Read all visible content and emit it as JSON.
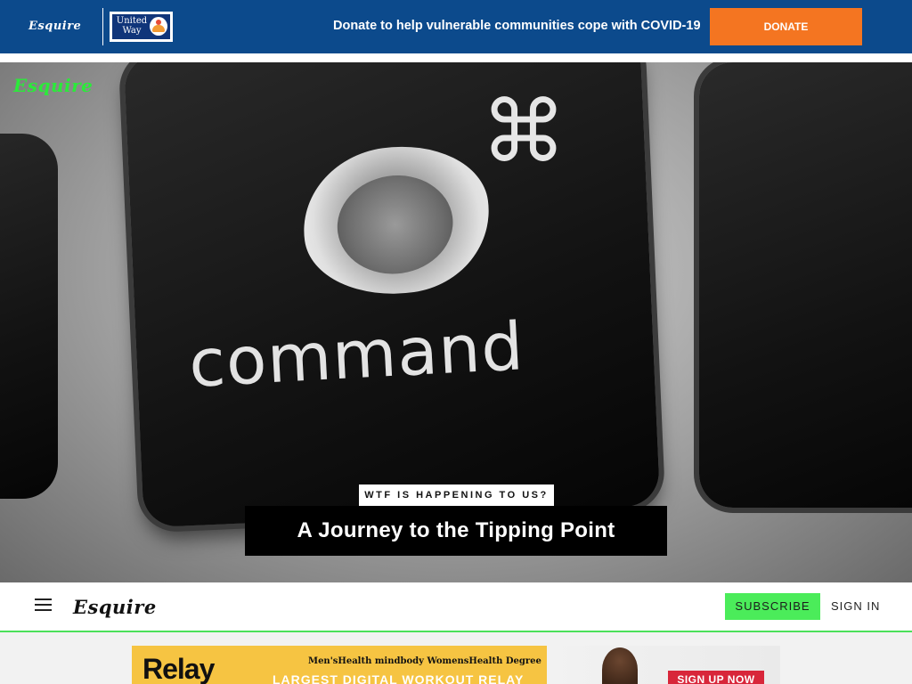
{
  "banner": {
    "logo": "Esquire",
    "partner_logo_text": "United Way",
    "message": "Donate to help vulnerable communities cope with COVID-19",
    "donate_label": "DONATE",
    "background_color": "#0c4a8c",
    "button_color": "#f47521"
  },
  "hero": {
    "logo": "Esquire",
    "image_key_label": "command",
    "image_key_symbol": "⌘",
    "kicker": "WTF IS HAPPENING TO US?",
    "title": "A Journey to the Tipping Point",
    "logo_color": "#2bea3a"
  },
  "nav": {
    "menu_icon": "hamburger-icon",
    "logo": "Esquire",
    "subscribe_label": "SUBSCRIBE",
    "signin_label": "SIGN IN",
    "accent_color": "#4bec5a"
  },
  "ad": {
    "brand": "Relay",
    "sponsors": "Men'sHealth  mindbody  WomensHealth  Degree",
    "tagline": "LARGEST DIGITAL WORKOUT RELAY",
    "cta": "SIGN UP NOW"
  }
}
